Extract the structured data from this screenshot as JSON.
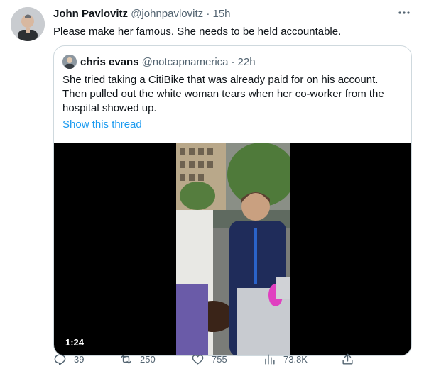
{
  "tweet": {
    "author_name": "John Pavlovitz",
    "author_handle": "@johnpavlovitz",
    "time": "15h",
    "text": "Please make her famous. She needs to be held accountable."
  },
  "quoted": {
    "author_name": "chris evans",
    "author_handle": "@notcapnamerica",
    "time": "22h",
    "text": "She tried taking a CitiBike that was already paid for on his account. Then pulled out the white woman tears when her co-worker from the hospital showed up.",
    "link": "Show this thread",
    "video_duration": "1:24"
  },
  "actions": {
    "replies": "39",
    "retweets": "250",
    "likes": "755",
    "views": "73.8K"
  },
  "separator": "·",
  "icons": [
    "more-icon",
    "reply-icon",
    "retweet-icon",
    "like-icon",
    "views-icon",
    "share-icon"
  ]
}
